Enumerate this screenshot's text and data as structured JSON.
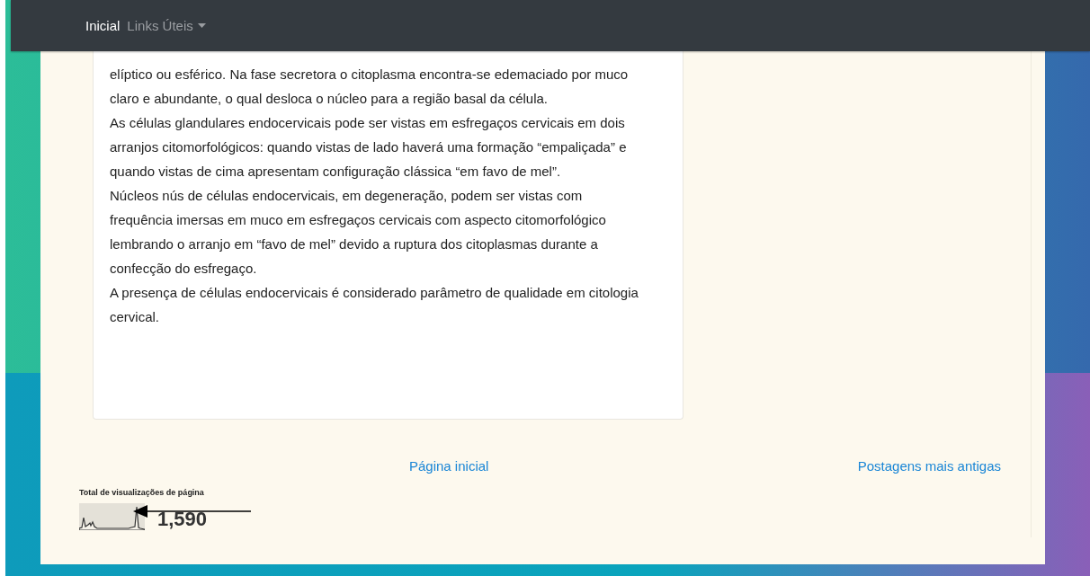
{
  "navbar": {
    "items": [
      {
        "label": "Inicial",
        "selected": true,
        "kind": "link"
      },
      {
        "label": "Links Úteis",
        "selected": false,
        "kind": "dropdown"
      }
    ]
  },
  "post": {
    "paragraphs": [
      "elíptico ou esférico. Na fase secretora o citoplasma encontra-se edemaciado por muco claro e abundante, o qual desloca o núcleo para a região basal da célula.",
      "As células glandulares endocervicais pode ser vistas em esfregaços cervicais em dois arranjos citomorfológicos: quando vistas de lado haverá uma formação “empaliçada” e quando vistas de cima apresentam configuração clássica “em favo de mel”.",
      "Núcleos nús de células endocervicais, em degeneração, podem ser vistas com frequência imersas em muco em esfregaços cervicais com aspecto citomorfológico lembrando o arranjo em “favo de mel” devido a ruptura dos citoplasmas durante a confecção do esfregaço.",
      "A presença de células endocervicais é considerado parâmetro de qualidade em citologia cervical."
    ]
  },
  "pager": {
    "newer": "Página inicial",
    "older": "Postagens mais antigas"
  },
  "stats": {
    "title": "Total de visualizações de página",
    "count": "1,590"
  }
}
